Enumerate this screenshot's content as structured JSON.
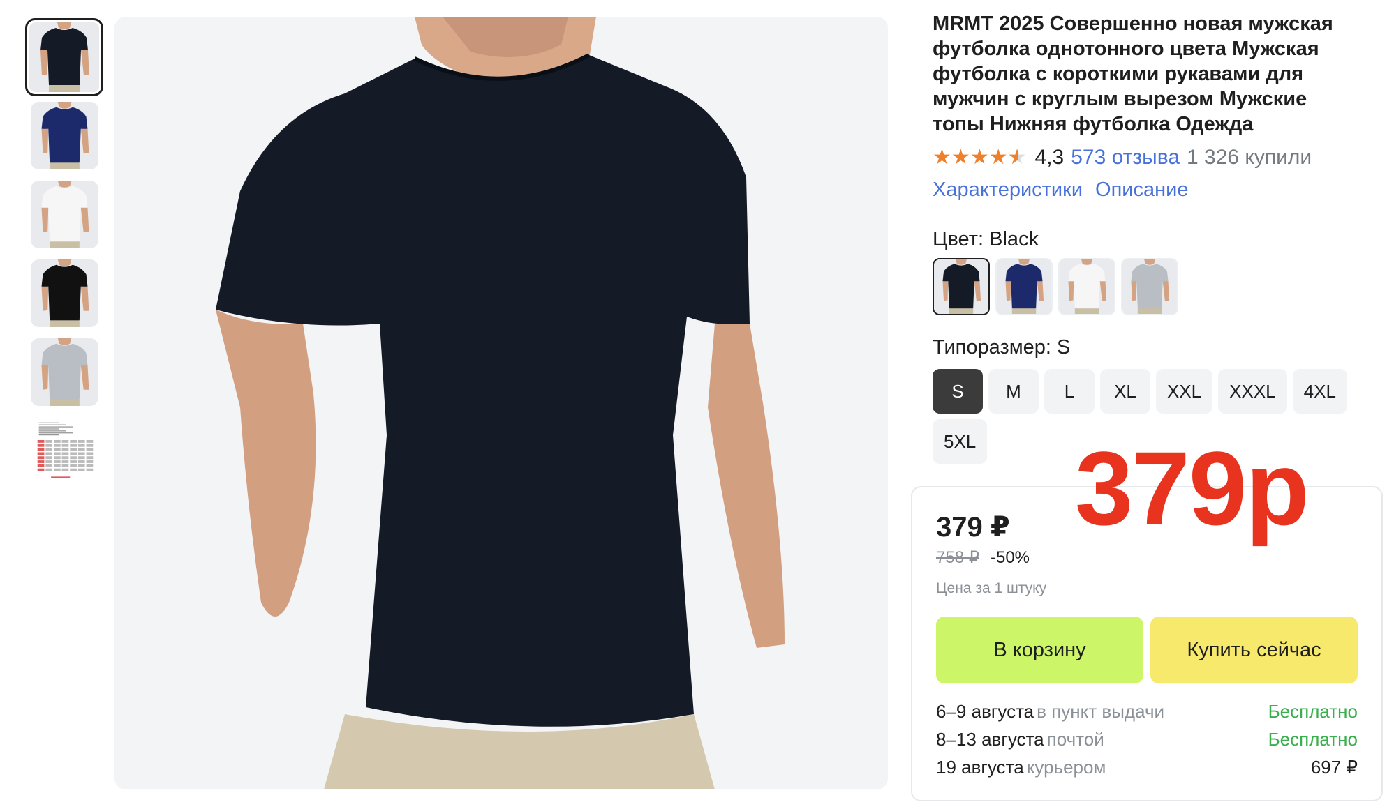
{
  "product": {
    "title": "MRMT 2025 Совершенно новая мужская футболка однотонного цвета Мужская футболка с короткими рукавами для мужчин с круглым вырезом Мужские топы Нижняя футболка Одежда",
    "rating": "4,3",
    "reviews": "573 отзыва",
    "bought": "1 326 купили",
    "stars_filled": 4.3
  },
  "links": {
    "specs": "Характеристики",
    "description": "Описание"
  },
  "color": {
    "label": "Цвет: Black",
    "options": [
      {
        "name": "Black",
        "shirt": "#141a26",
        "selected": true
      },
      {
        "name": "Navy",
        "shirt": "#1c2a6b",
        "selected": false
      },
      {
        "name": "White",
        "shirt": "#f6f6f6",
        "selected": false
      },
      {
        "name": "Gray",
        "shirt": "#b9bec4",
        "selected": false
      }
    ]
  },
  "size": {
    "label": "Типоразмер: S",
    "options": [
      "S",
      "M",
      "L",
      "XL",
      "XXL",
      "XXXL",
      "4XL",
      "5XL"
    ],
    "selected": "S"
  },
  "overlay_price": "379р",
  "price": {
    "current": "379 ₽",
    "old": "758 ₽",
    "discount": "-50%",
    "per_unit": "Цена за 1 штуку"
  },
  "buttons": {
    "cart": "В корзину",
    "buy": "Купить сейчас"
  },
  "delivery": [
    {
      "date": "6–9 августа",
      "method": "в пункт выдачи",
      "price": "Бесплатно",
      "free": true
    },
    {
      "date": "8–13 августа",
      "method": "почтой",
      "price": "Бесплатно",
      "free": true
    },
    {
      "date": "19 августа",
      "method": "курьером",
      "price": "697 ₽",
      "free": false
    }
  ],
  "thumbnails": [
    {
      "shirt": "#141a26",
      "selected": true
    },
    {
      "shirt": "#1c2a6b",
      "selected": false
    },
    {
      "shirt": "#f6f6f6",
      "selected": false
    },
    {
      "shirt": "#111111",
      "selected": false
    },
    {
      "shirt": "#b9bec4",
      "selected": false
    },
    {
      "kind": "size-chart",
      "selected": false
    }
  ],
  "colors": {
    "accent_link": "#4872d9",
    "star": "#f07f2b",
    "overlay_red": "#e8331f",
    "cart_button": "#ccf567",
    "buy_button": "#f7e96b",
    "free_green": "#3bae4e"
  }
}
